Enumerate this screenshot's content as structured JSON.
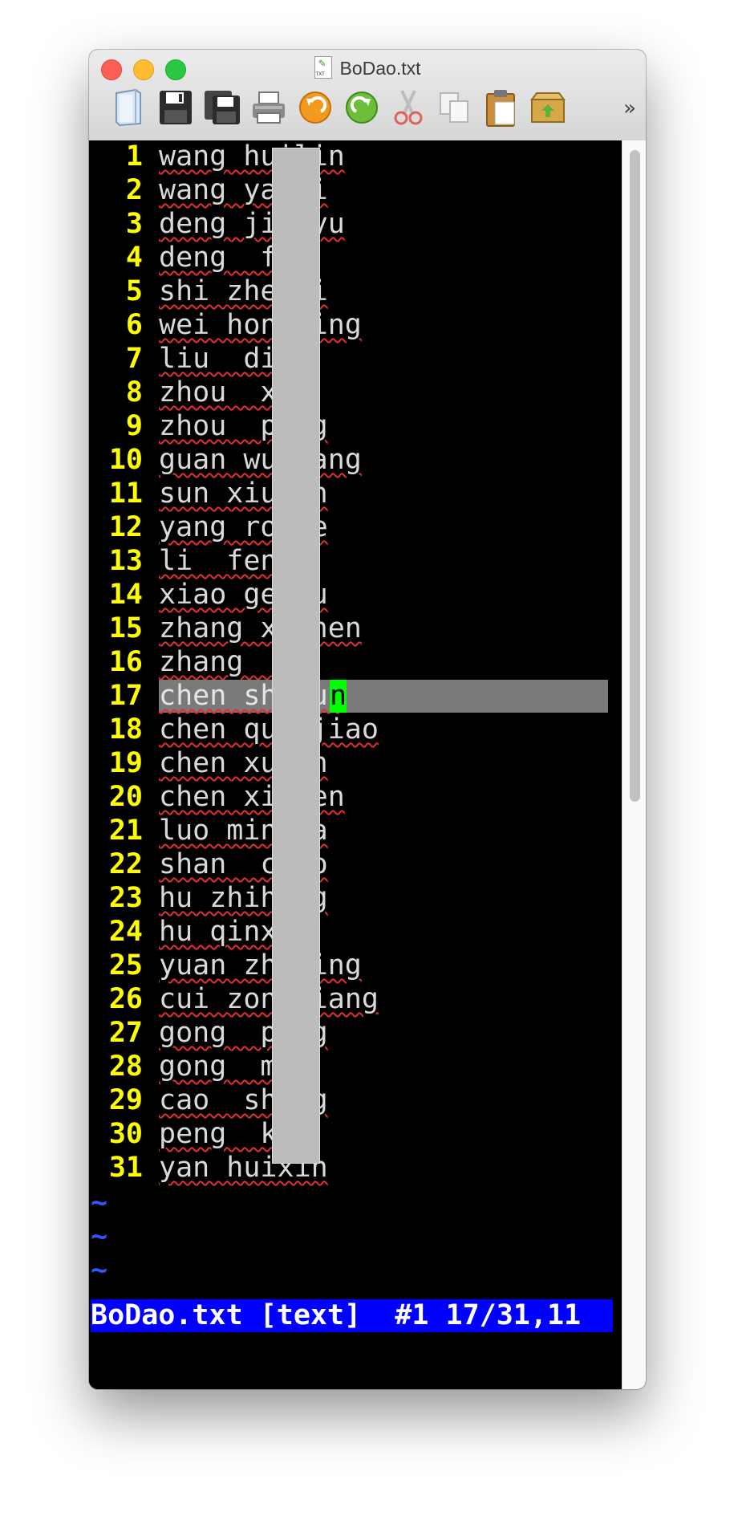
{
  "window": {
    "title": "BoDao.txt",
    "file_icon": "txt-file-icon"
  },
  "toolbar": {
    "buttons": [
      {
        "name": "open-icon"
      },
      {
        "name": "save-icon"
      },
      {
        "name": "save-all-icon"
      },
      {
        "name": "print-icon"
      },
      {
        "name": "undo-icon"
      },
      {
        "name": "redo-icon"
      },
      {
        "name": "cut-icon"
      },
      {
        "name": "copy-icon"
      },
      {
        "name": "paste-icon"
      },
      {
        "name": "find-icon"
      }
    ],
    "overflow_label": "»"
  },
  "editor": {
    "lines": [
      {
        "num": "1",
        "text": "wang huilin"
      },
      {
        "num": "2",
        "text": "wang yawei"
      },
      {
        "num": "3",
        "text": "deng jingyu"
      },
      {
        "num": "4",
        "text": "deng  fei"
      },
      {
        "num": "5",
        "text": "shi zhenli"
      },
      {
        "num": "6",
        "text": "wei hongbing"
      },
      {
        "num": "7",
        "text": "liu  dian"
      },
      {
        "num": "8",
        "text": "zhou  xu"
      },
      {
        "num": "9",
        "text": "zhou  peng"
      },
      {
        "num": "10",
        "text": "guan wuliang"
      },
      {
        "num": "11",
        "text": "sun xiuyan"
      },
      {
        "num": "12",
        "text": "yang ronge"
      },
      {
        "num": "13",
        "text": "li  feng"
      },
      {
        "num": "14",
        "text": "xiao genfu"
      },
      {
        "num": "15",
        "text": "zhang xuchen"
      },
      {
        "num": "16",
        "text": "zhang  li"
      },
      {
        "num": "17",
        "text": "chen shaoun"
      },
      {
        "num": "18",
        "text": "chen quanjiao"
      },
      {
        "num": "19",
        "text": "chen xuxin"
      },
      {
        "num": "20",
        "text": "chen xinsen"
      },
      {
        "num": "21",
        "text": "luo minhua"
      },
      {
        "num": "22",
        "text": "shan  chao"
      },
      {
        "num": "23",
        "text": "hu zhihong"
      },
      {
        "num": "24",
        "text": "hu qinxia"
      },
      {
        "num": "25",
        "text": "yuan zhuqing"
      },
      {
        "num": "26",
        "text": "cui zongjiang"
      },
      {
        "num": "27",
        "text": "gong  peng"
      },
      {
        "num": "28",
        "text": "gong  min"
      },
      {
        "num": "29",
        "text": "cao  sheng"
      },
      {
        "num": "30",
        "text": "peng  kai"
      },
      {
        "num": "31",
        "text": "yan huixin"
      }
    ],
    "current_line": "17",
    "cursor_char": "n",
    "tilde": "~"
  },
  "status": {
    "text": "BoDao.txt [text]  #1 17/31,11"
  },
  "colors": {
    "line_number": "#ffff00",
    "status_bg": "#0000ff",
    "cursor": "#00ff00",
    "spell_underline": "#e03030"
  }
}
